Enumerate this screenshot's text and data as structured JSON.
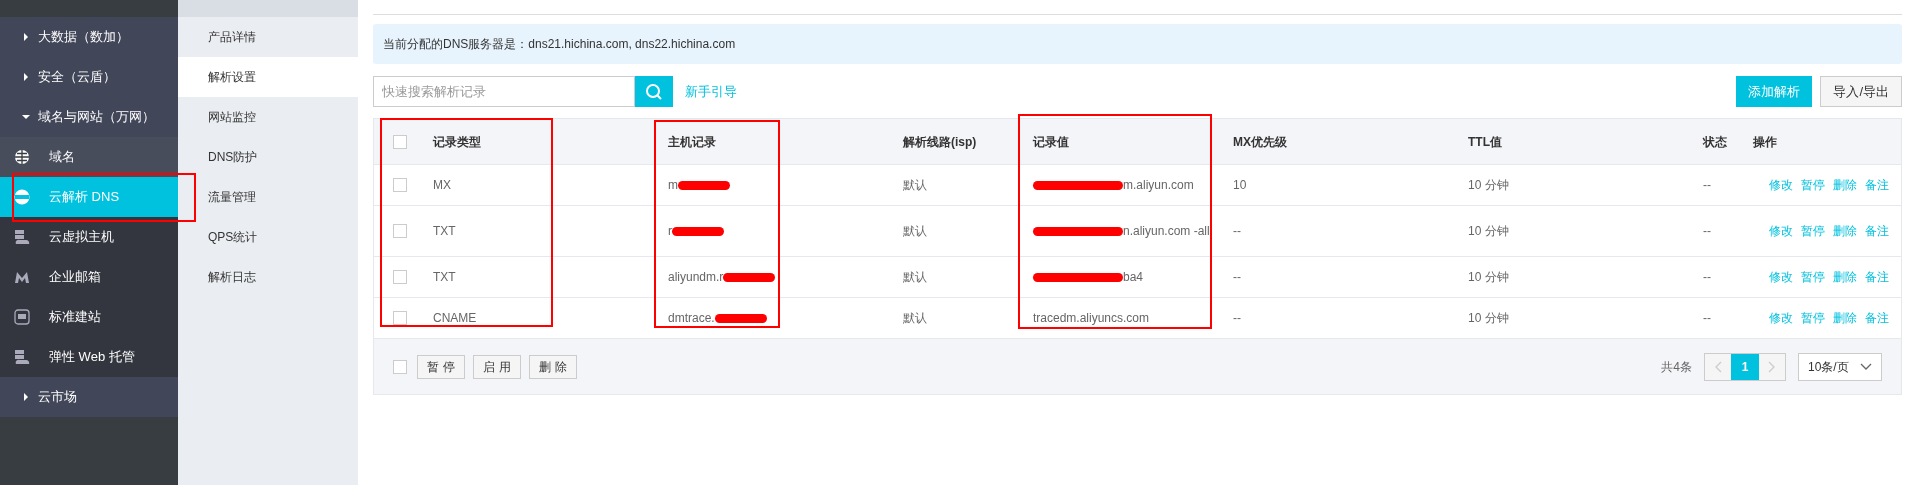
{
  "sidebar": {
    "items": [
      {
        "label": "大数据（数加）",
        "expanded": false
      },
      {
        "label": "安全（云盾）",
        "expanded": false
      },
      {
        "label": "域名与网站（万网）",
        "expanded": true,
        "children": [
          {
            "label": "域名",
            "selected": false
          },
          {
            "label": "云解析 DNS",
            "selected": true
          },
          {
            "label": "云虚拟主机",
            "selected": false
          },
          {
            "label": "企业邮箱",
            "selected": false
          },
          {
            "label": "标准建站",
            "selected": false
          },
          {
            "label": "弹性 Web 托管",
            "selected": false
          }
        ]
      },
      {
        "label": "云市场",
        "expanded": false
      }
    ]
  },
  "subnav": {
    "items": [
      {
        "label": "产品详情",
        "selected": false
      },
      {
        "label": "解析设置",
        "selected": true
      },
      {
        "label": "网站监控",
        "selected": false
      },
      {
        "label": "DNS防护",
        "selected": false
      },
      {
        "label": "流量管理",
        "selected": false
      },
      {
        "label": "QPS统计",
        "selected": false
      },
      {
        "label": "解析日志",
        "selected": false
      }
    ]
  },
  "notice": "当前分配的DNS服务器是：dns21.hichina.com, dns22.hichina.com",
  "search": {
    "placeholder": "快速搜索解析记录"
  },
  "guide_link": "新手引导",
  "buttons": [
    "添加解析",
    "导入/导出"
  ],
  "table": {
    "select_all": {
      "checked": false
    },
    "columns": [
      "记录类型",
      "主机记录",
      "解析线路(isp)",
      "记录值",
      "MX优先级",
      "TTL值",
      "状态",
      "操作"
    ],
    "rows": [
      {
        "checked": false,
        "cells": [
          "MX",
          "m",
          "默认",
          "m.aliyun.com",
          "10",
          "10 分钟",
          "--"
        ],
        "actions": [
          "修改",
          "暂停",
          "删除",
          "备注"
        ]
      },
      {
        "checked": false,
        "cells": [
          "TXT",
          "r",
          "默认",
          "n.aliyun.com -all",
          "--",
          "10 分钟",
          "--"
        ],
        "actions": [
          "修改",
          "暂停",
          "删除",
          "备注"
        ]
      },
      {
        "checked": false,
        "cells": [
          "TXT",
          "aliyundm.r",
          "默认",
          "ba4",
          "--",
          "10 分钟",
          "--"
        ],
        "actions": [
          "修改",
          "暂停",
          "删除",
          "备注"
        ]
      },
      {
        "checked": false,
        "cells": [
          "CNAME",
          "dmtrace.",
          "默认",
          "tracedm.aliyuncs.com",
          "--",
          "10 分钟",
          "--"
        ],
        "actions": [
          "修改",
          "暂停",
          "删除",
          "备注"
        ]
      }
    ]
  },
  "bulk_select": {
    "checked": false
  },
  "bulk_actions": [
    "暂 停",
    "启 用",
    "删 除"
  ],
  "pagination": {
    "total": "共4条",
    "pages": [
      {
        "label": "1",
        "selected": true
      }
    ],
    "page_size": "10条/页"
  }
}
